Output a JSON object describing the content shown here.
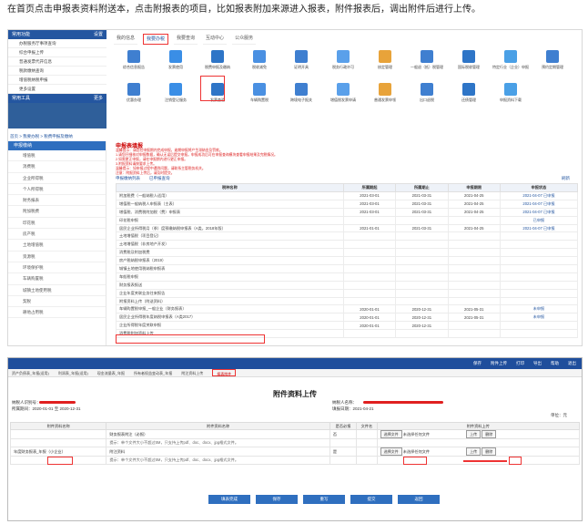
{
  "intro_text": "在首页点击申报表资料附送本，点击附报表的项目，比如报表附加来源进入报表，附件报表后，调出附件后进行上传。",
  "top": {
    "sidebar": {
      "head1": "常用功能",
      "head1_right": "设置",
      "items1": [
        "办税服务厅事项查询",
        "综合申报上传",
        "普通发票代开信息",
        "税款缴纳查询",
        "增值税纳税申报",
        "更多设置"
      ],
      "head2": "常用工具",
      "head2_right": "更多"
    },
    "tabs": [
      "我的信息",
      "我要办税",
      "我要查询",
      "互动中心",
      "公众服务"
    ],
    "tab_active_index": 1,
    "icons": [
      "综合信息报告",
      "发票使用",
      "税费申报及缴纳",
      "税收减免",
      "证明开具",
      "税务行政许可",
      "核定管理",
      "一般退（抵）税管理",
      "国际税收管理",
      "特定行业（企业）申报",
      "预约定期管理",
      "优惠办理",
      "注销登记服务",
      "发票查验",
      "车辆购置税",
      "跨境电子报关",
      "增值税发票申请",
      "普通发票申领",
      "出口退税",
      "还债管理",
      "申报资料下载"
    ],
    "breadcrumb": "首页 > 我要办税 > 税费申报及缴纳",
    "menu_head": "申报缴纳",
    "menu": [
      "增值税",
      "消费税",
      "企业所得税",
      "个人所得税",
      "财务报表",
      "附加税费",
      "印花税",
      "房产税",
      "土地增值税",
      "资源税",
      "环境保护税",
      "车辆购置税",
      "城镇土地使用税",
      "契税",
      "耕地占用税"
    ],
    "title": "申报表填报",
    "notes": [
      "温馨提示：请您在申报期内完成申报，逾期申报将产生滞纳金及罚款。",
      "1.请您仔细核对申报数据，确认无误后提交申报。申报成功后可在申报查询模块查看申报结果及完税情况。",
      "2.如需更正申报，请在申报期内进行更正申报。",
      "3.附报资料请按要求上传。",
      "温馨提示：如申报过程中遇到问题，请联系主管税务机关。",
      "注意：附报资料上传后，请及时提交。"
    ],
    "subtabs": [
      "申报缴纳列表",
      "已申报查询"
    ],
    "refresh": "刷新",
    "columns": [
      "税种名称",
      "所属期起",
      "所属期止",
      "申报期限",
      "申报状态"
    ],
    "rows": [
      [
        "附加税费（一般纳税人适用）",
        "2021-03-01",
        "2021-03-31",
        "2021-04-25",
        "2021-04-07 已申报"
      ],
      [
        "增值税一般纳税人申报表（主表）",
        "2021-03-01",
        "2021-03-31",
        "2021-04-25",
        "2021-04-07 已申报"
      ],
      [
        "增值税、消费税附加税（费）申报表",
        "2021-03-01",
        "2021-03-31",
        "2021-04-25",
        "2021-04-07 已申报"
      ],
      [
        "印花税申报",
        "",
        "",
        "",
        "已申报"
      ],
      [
        "居民企业所得税月（季）度预缴纳税申报表（A类，2018年版）",
        "2021-01-01",
        "2021-03-31",
        "2021-04-25",
        "2021-04-07 已申报"
      ],
      [
        "土地增值税（项目登记）",
        "",
        "",
        "",
        ""
      ],
      [
        "土地增值税（非房地产开发）",
        "",
        "",
        "",
        ""
      ],
      [
        "消费税及附加税费",
        "",
        "",
        "",
        ""
      ],
      [
        "房产税纳税申报表（2019）",
        "",
        "",
        "",
        ""
      ],
      [
        "城镇土地使用税纳税申报表",
        "",
        "",
        "",
        ""
      ],
      [
        "车船税申报",
        "",
        "",
        "",
        ""
      ],
      [
        "财务报表报送",
        "",
        "",
        "",
        ""
      ],
      [
        "企业年度关联业务往来报告",
        "",
        "",
        "",
        ""
      ],
      [
        "附报资料上传（附送资料）",
        "",
        "",
        "",
        ""
      ],
      [
        "车辆购置税申报_一般企业（财务报表）",
        "2020-01-01",
        "2020-12-31",
        "2021-05-31",
        "未申报"
      ],
      [
        "居民企业所得税年度纳税申报表（A类2017）",
        "2020-01-01",
        "2020-12-31",
        "2021-05-31",
        "未申报"
      ],
      [
        "企业所得税年度关联申报",
        "2020-01-01",
        "2020-12-31",
        "",
        ""
      ],
      [
        "消费税附加资料上传",
        "",
        "",
        "",
        ""
      ]
    ]
  },
  "bottom": {
    "toolbar": [
      "保存",
      "附件上传",
      "打印",
      "导出",
      "帮助",
      "退出"
    ],
    "nav": [
      "资产负债表_年报(适用)",
      "利润表_年报(适用)",
      "现金流量表_年报",
      "所有者权益变动表_年报",
      "附注资料上传",
      "报表附件"
    ],
    "nav_active_index": 5,
    "title": "附件资料上传",
    "labels": {
      "taxpayer_name": "纳税人识别号：",
      "period": "所属期间：2020-01-01 至 2020-12-31",
      "taxpayer_no": "纳税人名称：",
      "fill_date": "填报日期：2021-04-21",
      "unit": "单位：元"
    },
    "columns": [
      "附件资料名称",
      "附件资料名称",
      "是否必报",
      "文件名",
      "附件资料上传"
    ],
    "rows": [
      {
        "group": "",
        "name": "财务报表附注（必报）",
        "req": "否",
        "file": "",
        "btn1": "选择文件",
        "hint1": "未选择任何文件",
        "btn2": "上传",
        "btn3": "删除"
      },
      {
        "group": "",
        "name": "提示：单个文件大小不超过5M，只支持上传pdf、doc、docx、jpg格式文件。",
        "req": "",
        "file": "",
        "btn1": "",
        "hint1": "",
        "btn2": "",
        "btn3": ""
      },
      {
        "group": "年度财务报表_年报（小企业）",
        "name": "附注资料",
        "req": "是",
        "file": "",
        "btn1": "选择文件",
        "hint1": "未选择任何文件",
        "btn2": "上传",
        "btn3": "删除"
      },
      {
        "group": "",
        "name": "提示：单个文件大小不超过5M，只支持上传pdf、doc、docx、jpg格式文件。",
        "req": "",
        "file": "",
        "btn1": "",
        "hint1": "",
        "btn2": "",
        "btn3": ""
      }
    ],
    "buttons": [
      "填表完成",
      "保存",
      "重写",
      "提交",
      "返回"
    ]
  }
}
